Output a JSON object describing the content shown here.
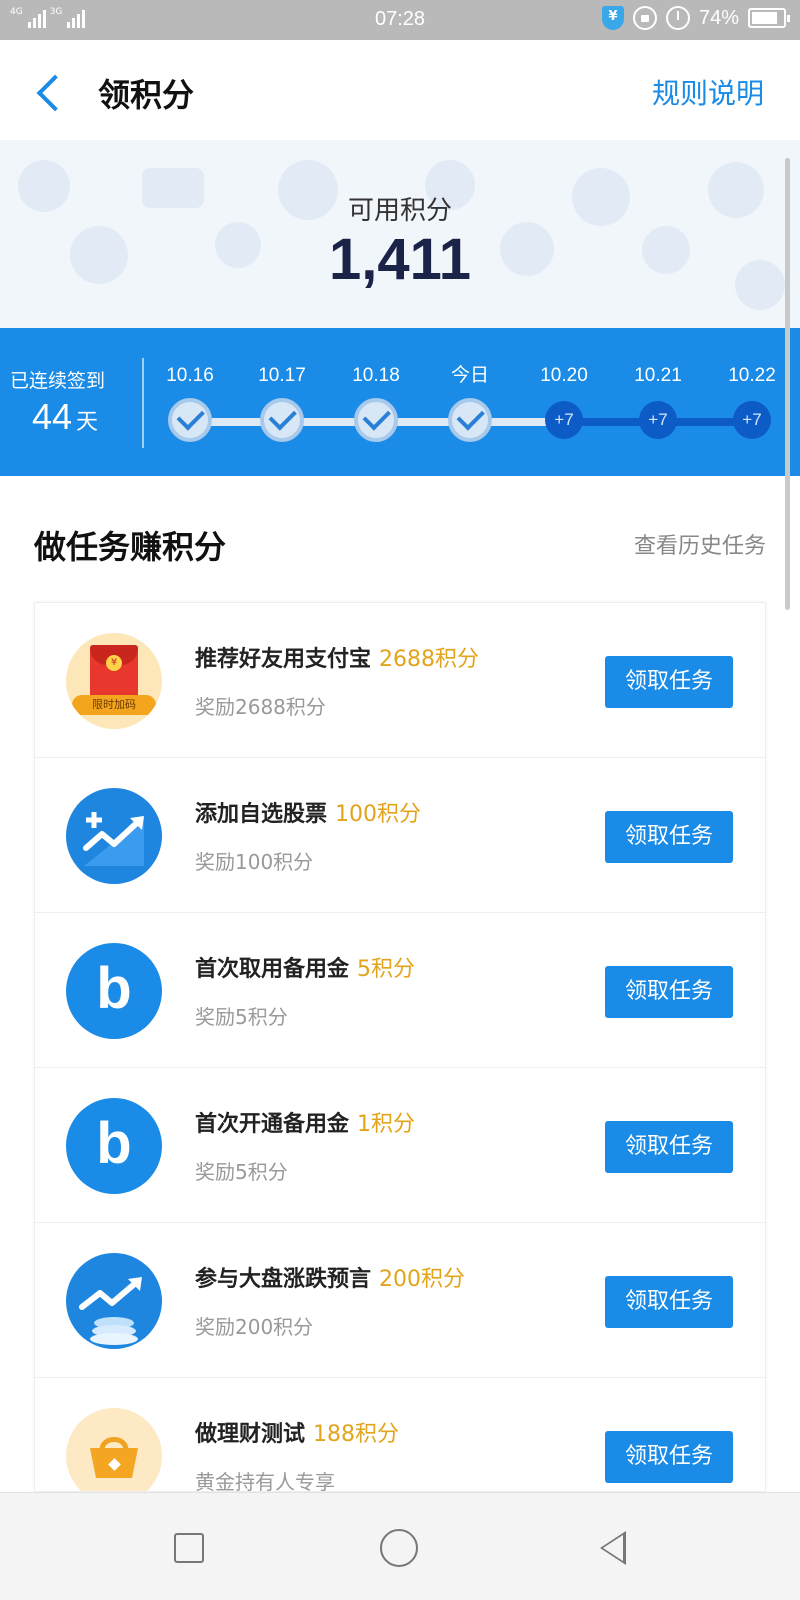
{
  "status_bar": {
    "network_1": "4G",
    "network_2": "3G",
    "time": "07:28",
    "battery": "74%",
    "shield_icon": "shield-yen-icon",
    "lock_icon": "rotation-lock-icon",
    "alarm_icon": "alarm-icon"
  },
  "header": {
    "title": "领积分",
    "rules_label": "规则说明",
    "back_icon": "chevron-left-icon"
  },
  "points": {
    "label": "可用积分",
    "value": "1,411"
  },
  "checkin": {
    "streak_label": "已连续签到",
    "streak_days": "44",
    "streak_unit": "天",
    "days": [
      {
        "label": "10.16",
        "status": "done",
        "text": ""
      },
      {
        "label": "10.17",
        "status": "done",
        "text": ""
      },
      {
        "label": "10.18",
        "status": "done",
        "text": ""
      },
      {
        "label": "今日",
        "status": "done",
        "text": ""
      },
      {
        "label": "10.20",
        "status": "todo",
        "text": "+7"
      },
      {
        "label": "10.21",
        "status": "todo",
        "text": "+7"
      },
      {
        "label": "10.22",
        "status": "todo",
        "text": "+7"
      }
    ]
  },
  "tasks_section": {
    "title": "做任务赚积分",
    "history_label": "查看历史任务",
    "button_label": "领取任务",
    "items": [
      {
        "name": "推荐好友用支付宝",
        "points": "2688积分",
        "desc": "奖励2688积分",
        "icon": "red-packet-icon",
        "icon_badge": "限时加码",
        "icon_symbol": "¥"
      },
      {
        "name": "添加自选股票",
        "points": "100积分",
        "desc": "奖励100积分",
        "icon": "stock-add-icon"
      },
      {
        "name": "首次取用备用金",
        "points": "5积分",
        "desc": "奖励5积分",
        "icon": "b-logo-icon",
        "icon_symbol": "b"
      },
      {
        "name": "首次开通备用金",
        "points": "1积分",
        "desc": "奖励5积分",
        "icon": "b-logo-icon",
        "icon_symbol": "b"
      },
      {
        "name": "参与大盘涨跌预言",
        "points": "200积分",
        "desc": "奖励200积分",
        "icon": "trend-coins-icon"
      },
      {
        "name": "做理财测试",
        "points": "188积分",
        "desc": "黄金持有人专享",
        "icon": "shopping-bag-icon"
      }
    ]
  },
  "nav_bar": {
    "recent_icon": "square-icon",
    "home_icon": "circle-icon",
    "back_icon": "triangle-back-icon"
  },
  "colors": {
    "accent": "#1a8be6",
    "points_orange": "#e2a41b",
    "pending_day": "#0c5bc7"
  }
}
